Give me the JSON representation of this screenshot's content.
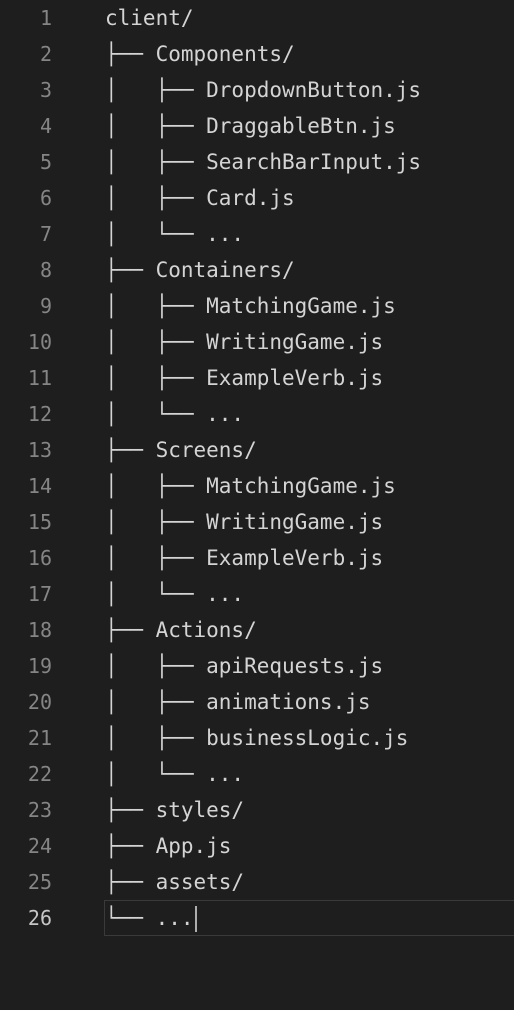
{
  "editor": {
    "lines": [
      {
        "number": "1",
        "text": "client/"
      },
      {
        "number": "2",
        "text": "├── Components/"
      },
      {
        "number": "3",
        "text": "│   ├── DropdownButton.js"
      },
      {
        "number": "4",
        "text": "│   ├── DraggableBtn.js"
      },
      {
        "number": "5",
        "text": "│   ├── SearchBarInput.js"
      },
      {
        "number": "6",
        "text": "│   ├── Card.js"
      },
      {
        "number": "7",
        "text": "│   └── ..."
      },
      {
        "number": "8",
        "text": "├── Containers/"
      },
      {
        "number": "9",
        "text": "│   ├── MatchingGame.js"
      },
      {
        "number": "10",
        "text": "│   ├── WritingGame.js"
      },
      {
        "number": "11",
        "text": "│   ├── ExampleVerb.js"
      },
      {
        "number": "12",
        "text": "│   └── ..."
      },
      {
        "number": "13",
        "text": "├── Screens/"
      },
      {
        "number": "14",
        "text": "│   ├── MatchingGame.js"
      },
      {
        "number": "15",
        "text": "│   ├── WritingGame.js"
      },
      {
        "number": "16",
        "text": "│   ├── ExampleVerb.js"
      },
      {
        "number": "17",
        "text": "│   └── ..."
      },
      {
        "number": "18",
        "text": "├── Actions/"
      },
      {
        "number": "19",
        "text": "│   ├── apiRequests.js"
      },
      {
        "number": "20",
        "text": "│   ├── animations.js"
      },
      {
        "number": "21",
        "text": "│   ├── businessLogic.js"
      },
      {
        "number": "22",
        "text": "│   └── ..."
      },
      {
        "number": "23",
        "text": "├── styles/"
      },
      {
        "number": "24",
        "text": "├── App.js"
      },
      {
        "number": "25",
        "text": "├── assets/"
      },
      {
        "number": "26",
        "text": "└── ..."
      }
    ],
    "active_line": "26",
    "colors": {
      "background": "#1e1e1e",
      "text": "#d4d4d4",
      "line_number": "#858585",
      "active_line_number": "#c6c6c6",
      "cursor": "#aeafad"
    }
  }
}
